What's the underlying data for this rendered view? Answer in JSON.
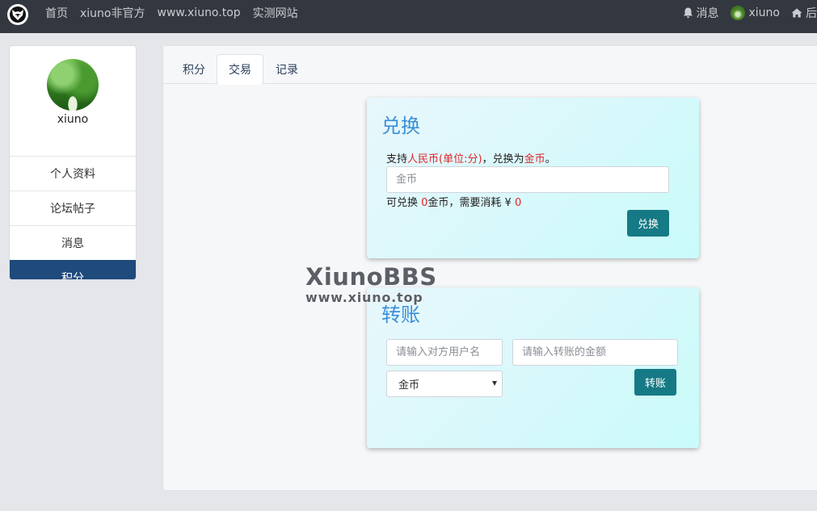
{
  "nav": {
    "links": [
      "首页",
      "xiuno非官方",
      "www.xiuno.top",
      "实测网站"
    ],
    "messages_label": "消息",
    "username": "xiuno",
    "admin_label": "后"
  },
  "sidebar": {
    "username": "xiuno",
    "items": [
      {
        "label": "个人资料",
        "active": false
      },
      {
        "label": "论坛帖子",
        "active": false
      },
      {
        "label": "消息",
        "active": false
      },
      {
        "label": "积分",
        "active": true
      }
    ]
  },
  "tabs": [
    {
      "label": "积分",
      "active": false
    },
    {
      "label": "交易",
      "active": true
    },
    {
      "label": "记录",
      "active": false
    }
  ],
  "exchange": {
    "title": "兑换",
    "desc_prefix": "支持",
    "desc_currency": "人民币(单位:分)",
    "desc_middle": "，兑换为",
    "desc_target": "金币",
    "desc_suffix": "。",
    "input_placeholder": "金币",
    "info_prefix": "可兑换 ",
    "info_amount": "0",
    "info_middle": "金币，需要消耗 ¥ ",
    "info_cost": "0",
    "button_label": "兑换"
  },
  "transfer": {
    "title": "转账",
    "user_placeholder": "请输入对方用户名",
    "amount_placeholder": "请输入转账的金额",
    "currency_selected": "金币",
    "button_label": "转账"
  },
  "watermark": {
    "title": "XiunoBBS",
    "subtitle": "www.xiuno.top"
  },
  "colors": {
    "navbar": "#333840",
    "active_menu": "#1f4a7c",
    "button": "#157a85",
    "card_title": "#3b8fd6",
    "highlight": "#e0262b"
  }
}
